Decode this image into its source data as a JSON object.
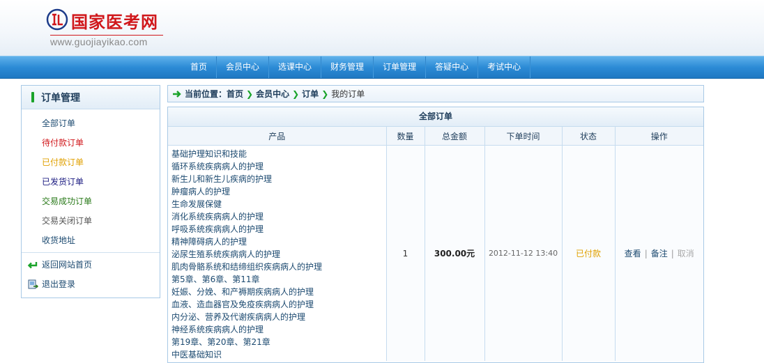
{
  "header": {
    "logo_text": "国家医考网",
    "logo_url": "www.guojiayikao.com"
  },
  "nav": {
    "items": [
      "首页",
      "会员中心",
      "选课中心",
      "财务管理",
      "订单管理",
      "答疑中心",
      "考试中心"
    ]
  },
  "sidebar": {
    "title": "订单管理",
    "items": [
      {
        "label": "全部订单",
        "color": "#1c4a70"
      },
      {
        "label": "待付款订单",
        "color": "#d0171b"
      },
      {
        "label": "已付款订单",
        "color": "#e0a000"
      },
      {
        "label": "已发货订单",
        "color": "#1a1a80"
      },
      {
        "label": "交易成功订单",
        "color": "#2a7a1a"
      },
      {
        "label": "交易关闭订单",
        "color": "#555555"
      },
      {
        "label": "收货地址",
        "color": "#1c4a70"
      }
    ],
    "links": [
      {
        "label": "返回网站首页",
        "icon": "return-arrow-icon"
      },
      {
        "label": "退出登录",
        "icon": "logout-icon"
      }
    ]
  },
  "breadcrumb": {
    "prefix": "当前位置：",
    "items": [
      "首页",
      "会员中心",
      "订单",
      "我的订单"
    ]
  },
  "orders": {
    "title": "全部订单",
    "columns": [
      "产品",
      "数量",
      "总金额",
      "下单时间",
      "状态",
      "操作"
    ],
    "rows": [
      {
        "products": [
          "基础护理知识和技能",
          "循环系统疾病病人的护理",
          "新生儿和新生儿疾病的护理",
          "肿瘤病人的护理",
          "生命发展保健",
          "消化系统疾病病人的护理",
          "呼吸系统疾病病人的护理",
          "精神障碍病人的护理",
          "泌尿生殖系统疾病病人的护理",
          "肌肉骨骼系统和结缔组织疾病病人的护理",
          "第5章、第6章、第11章",
          "妊娠、分娩、和产褥期疾病病人的护理",
          "血液、造血器官及免疫疾病病人的护理",
          "内分泌、营养及代谢疾病病人的护理",
          "神经系统疾病病人的护理",
          "第19章、第20章、第21章",
          "中医基础知识"
        ],
        "quantity": "1",
        "amount": "300.00元",
        "time": "2012-11-12 13:40",
        "status": "已付款",
        "actions": {
          "view": "查看",
          "note": "备注",
          "cancel": "取消"
        }
      }
    ]
  },
  "colors": {
    "nav_blue": "#2c8bd6",
    "logo_red": "#d0171b",
    "status_paid": "#e0a000"
  }
}
